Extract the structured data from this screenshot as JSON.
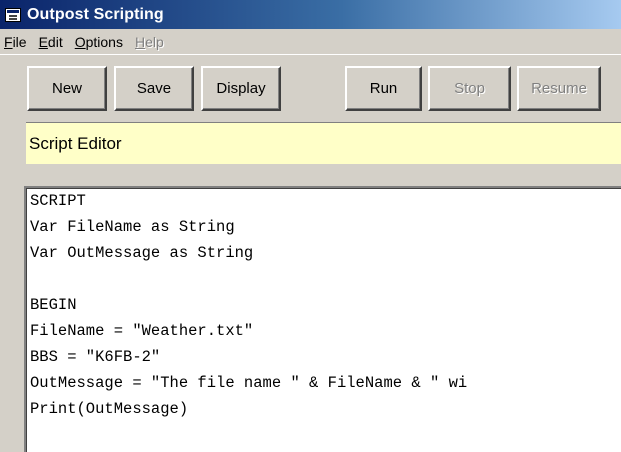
{
  "window": {
    "title": "Outpost Scripting",
    "icon": "app-window-icon"
  },
  "menu": [
    {
      "label": "File",
      "accel": "F",
      "rest": "ile",
      "disabled": false
    },
    {
      "label": "Edit",
      "accel": "E",
      "rest": "dit",
      "disabled": false
    },
    {
      "label": "Options",
      "accel": "O",
      "rest": "ptions",
      "disabled": false
    },
    {
      "label": "Help",
      "accel": "H",
      "rest": "elp",
      "disabled": true
    }
  ],
  "toolbar": {
    "new_label": "New",
    "save_label": "Save",
    "display_label": "Display",
    "run_label": "Run",
    "stop_label": "Stop",
    "resume_label": "Resume"
  },
  "editor": {
    "header": "Script Editor",
    "lines": [
      "SCRIPT",
      "Var FileName as String",
      "Var OutMessage as String",
      "",
      "BEGIN",
      "FileName = \"Weather.txt\"",
      "BBS = \"K6FB-2\"",
      "OutMessage = \"The file name \" & FileName & \" wi",
      "Print(OutMessage)"
    ]
  }
}
